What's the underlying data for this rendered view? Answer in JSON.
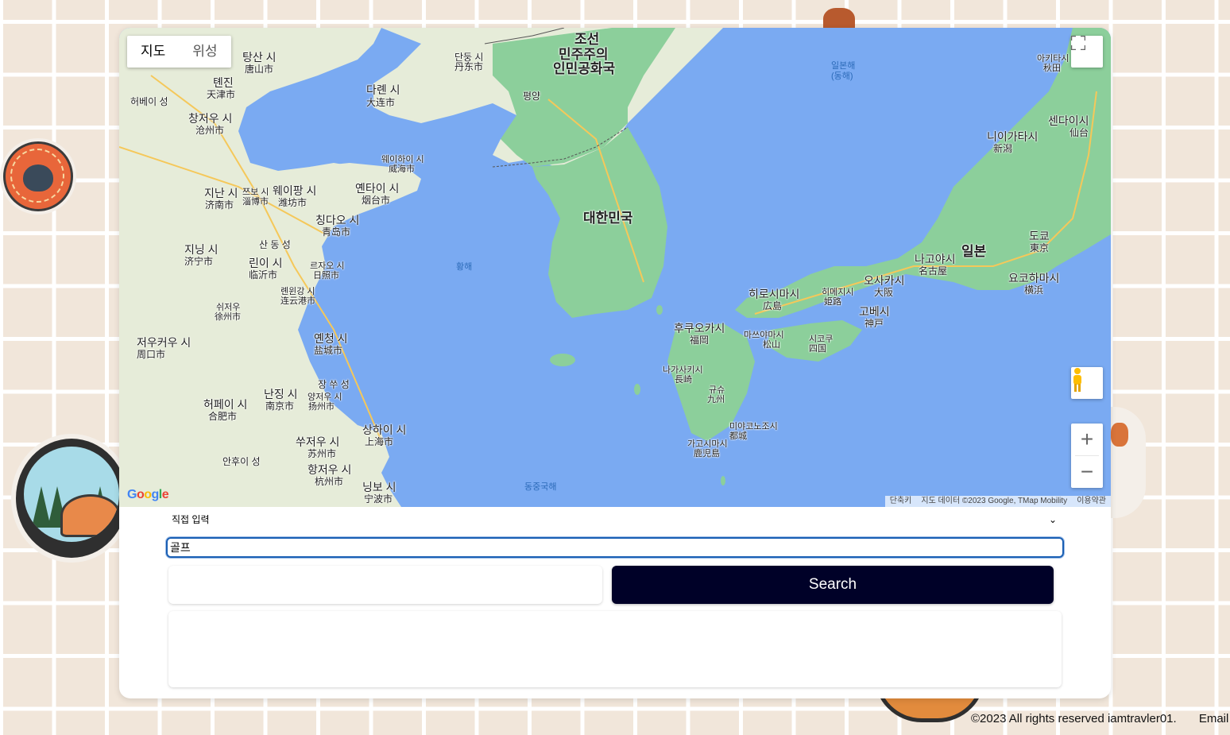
{
  "map": {
    "map_types": [
      "지도",
      "위성"
    ],
    "active_map_type": "지도",
    "labels": {
      "north_korea_1": "조선",
      "north_korea_2": "민주주의",
      "north_korea_3": "인민공화국",
      "south_korea": "대한민국",
      "japan": "일본",
      "pyongyang": "평양",
      "yellow_sea": "황해",
      "east_sea_1": "일본해",
      "east_sea_2": "(동해)",
      "east_china_sea": "동중국해",
      "tangshan": "탕산 시",
      "tangshan_cn": "唐山市",
      "tianjin": "톈진",
      "tianjin_cn": "天津市",
      "hebei": "허베이 성",
      "cangzhou": "창저우 시",
      "cangzhou_cn": "沧州市",
      "dalian": "다롄 시",
      "dalian_cn": "大连市",
      "dandong": "단둥 시",
      "dandong_cn": "丹东市",
      "weihai": "웨이하이 시",
      "weihai_cn": "威海市",
      "yantai": "옌타이 시",
      "yantai_cn": "烟台市",
      "weifang": "웨이팡 시",
      "weifang_cn": "潍坊市",
      "jinan": "지난 시",
      "jinan_cn": "济南市",
      "zibo": "쯔보 시",
      "zibo_cn": "淄博市",
      "qingdao": "칭다오 시",
      "qingdao_cn": "青岛市",
      "shandong": "산 동 성",
      "jining": "지닝 시",
      "jining_cn": "济宁市",
      "linyi": "린이 시",
      "linyi_cn": "临沂市",
      "rizhao": "르자오 시",
      "rizhao_cn": "日照市",
      "lianyungang": "롄윈강 시",
      "lianyungang_cn": "连云港市",
      "xuzhou": "쉬저우",
      "xuzhou_cn": "徐州市",
      "zhoukou": "저우커우 시",
      "zhoukou_cn": "周口市",
      "yancheng": "옌청 시",
      "yancheng_cn": "盐城市",
      "jiangsu": "장 쑤 성",
      "hefei": "허페이 시",
      "hefei_cn": "合肥市",
      "nanjing": "난징 시",
      "nanjing_cn": "南京市",
      "yangzhou": "양저우 시",
      "yangzhou_cn": "扬州市",
      "suzhou": "쑤저우 시",
      "suzhou_cn": "苏州市",
      "shanghai": "상하이 시",
      "shanghai_cn": "上海市",
      "hangzhou": "항저우 시",
      "hangzhou_cn": "杭州市",
      "ningbo": "닝보 시",
      "ningbo_cn": "宁波市",
      "anhui": "안후이 성",
      "niigata": "니이가타시",
      "niigata_cn": "新潟",
      "sendai": "센다이시",
      "sendai_cn": "仙台",
      "akita": "아키타시",
      "akita_cn": "秋田",
      "tokyo": "도쿄",
      "tokyo_cn": "東京",
      "yokohama": "요코하마시",
      "yokohama_cn": "横浜",
      "nagoya": "나고야시",
      "nagoya_cn": "名古屋",
      "osaka": "오사카시",
      "osaka_cn": "大阪",
      "kobe": "고베시",
      "kobe_cn": "神戸",
      "himeji": "히메지시",
      "himeji_cn": "姫路",
      "hiroshima": "히로시마시",
      "hiroshima_cn": "広島",
      "matsuyama": "마쓰야마시",
      "matsuyama_cn": "松山",
      "shikoku": "시코쿠",
      "shikoku_cn": "四国",
      "fukuoka": "후쿠오카시",
      "fukuoka_cn": "福岡",
      "nagasaki": "나가사키시",
      "nagasaki_cn": "長崎",
      "kyushu": "규슈",
      "kyushu_cn": "九州",
      "miyakonojo": "미야코노조시",
      "miyakonojo_cn": "都城",
      "kagoshima": "가고시마시",
      "kagoshima_cn": "鹿児島"
    },
    "attribution": {
      "shortcuts": "단축키",
      "data": "지도 데이터 ©2023 Google, TMap Mobility",
      "terms": "이용약관"
    },
    "logo": "Google"
  },
  "form": {
    "select_value": "직접 입력",
    "text_input_value": "골프",
    "search_label": "Search"
  },
  "footer": {
    "copyright": "©2023 All rights reserved iamtravler01.",
    "email": "Email"
  },
  "colors": {
    "water": "#7aaaf2",
    "land": "#e9efe4",
    "search_button": "#000128",
    "background": "#f1e6da"
  }
}
